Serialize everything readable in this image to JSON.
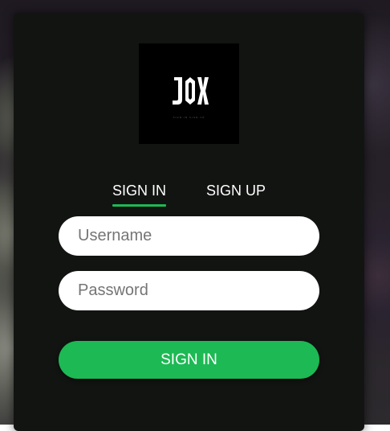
{
  "logo": {
    "text": "JOX",
    "tagline": "SIGN IN SIGN UP",
    "icon": "brand-logo"
  },
  "tabs": [
    {
      "label": "SIGN IN",
      "active": true
    },
    {
      "label": "SIGN UP",
      "active": false
    }
  ],
  "form": {
    "username_placeholder": "Username",
    "password_placeholder": "Password",
    "submit_label": "SIGN IN"
  },
  "colors": {
    "accent": "#1db954",
    "card": "#121412",
    "text": "#ffffff"
  }
}
